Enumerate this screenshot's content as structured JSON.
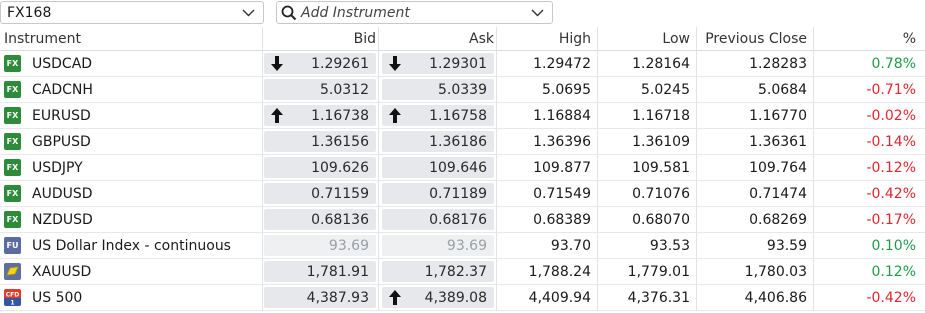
{
  "toolbar": {
    "list_value": "FX168",
    "search_placeholder": "Add Instrument"
  },
  "columns": {
    "instrument": "Instrument",
    "bid": "Bid",
    "ask": "Ask",
    "high": "High",
    "low": "Low",
    "previous_close": "Previous Close",
    "change_pct": "%"
  },
  "colors": {
    "positive": "#1e9c48",
    "negative": "#e3262f",
    "fx_badge": "#2e8b3a"
  },
  "rows": [
    {
      "badge": "FX",
      "badge_type": "fx",
      "name": "USDCAD",
      "bid": "1.29261",
      "bid_arrow": "down",
      "ask": "1.29301",
      "ask_arrow": "down",
      "high": "1.29472",
      "low": "1.28164",
      "prev": "1.28283",
      "pct": "0.78%",
      "dir": "pos"
    },
    {
      "badge": "FX",
      "badge_type": "fx",
      "name": "CADCNH",
      "bid": "5.0312",
      "bid_arrow": "",
      "ask": "5.0339",
      "ask_arrow": "",
      "high": "5.0695",
      "low": "5.0245",
      "prev": "5.0684",
      "pct": "-0.71%",
      "dir": "neg"
    },
    {
      "badge": "FX",
      "badge_type": "fx",
      "name": "EURUSD",
      "bid": "1.16738",
      "bid_arrow": "up",
      "ask": "1.16758",
      "ask_arrow": "up",
      "high": "1.16884",
      "low": "1.16718",
      "prev": "1.16770",
      "pct": "-0.02%",
      "dir": "neg"
    },
    {
      "badge": "FX",
      "badge_type": "fx",
      "name": "GBPUSD",
      "bid": "1.36156",
      "bid_arrow": "",
      "ask": "1.36186",
      "ask_arrow": "",
      "high": "1.36396",
      "low": "1.36109",
      "prev": "1.36361",
      "pct": "-0.14%",
      "dir": "neg"
    },
    {
      "badge": "FX",
      "badge_type": "fx",
      "name": "USDJPY",
      "bid": "109.626",
      "bid_arrow": "",
      "ask": "109.646",
      "ask_arrow": "",
      "high": "109.877",
      "low": "109.581",
      "prev": "109.764",
      "pct": "-0.12%",
      "dir": "neg"
    },
    {
      "badge": "FX",
      "badge_type": "fx",
      "name": "AUDUSD",
      "bid": "0.71159",
      "bid_arrow": "",
      "ask": "0.71189",
      "ask_arrow": "",
      "high": "0.71549",
      "low": "0.71076",
      "prev": "0.71474",
      "pct": "-0.42%",
      "dir": "neg"
    },
    {
      "badge": "FX",
      "badge_type": "fx",
      "name": "NZDUSD",
      "bid": "0.68136",
      "bid_arrow": "",
      "ask": "0.68176",
      "ask_arrow": "",
      "high": "0.68389",
      "low": "0.68070",
      "prev": "0.68269",
      "pct": "-0.17%",
      "dir": "neg"
    },
    {
      "badge": "FU",
      "badge_type": "fu",
      "name": "US Dollar Index - continuous",
      "bid": "93.69",
      "bid_arrow": "",
      "ask": "93.69",
      "ask_arrow": "",
      "high": "93.70",
      "low": "93.53",
      "prev": "93.59",
      "pct": "0.10%",
      "dir": "pos",
      "dim": true
    },
    {
      "badge": "",
      "badge_type": "gold",
      "name": "XAUUSD",
      "bid": "1,781.91",
      "bid_arrow": "",
      "ask": "1,782.37",
      "ask_arrow": "",
      "high": "1,788.24",
      "low": "1,779.01",
      "prev": "1,780.03",
      "pct": "0.12%",
      "dir": "pos"
    },
    {
      "badge": "CFD",
      "badge_type": "cfd",
      "name": "US 500",
      "bid": "4,387.93",
      "bid_arrow": "",
      "ask": "4,389.08",
      "ask_arrow": "up",
      "high": "4,409.94",
      "low": "4,376.31",
      "prev": "4,406.86",
      "pct": "-0.42%",
      "dir": "neg"
    }
  ]
}
